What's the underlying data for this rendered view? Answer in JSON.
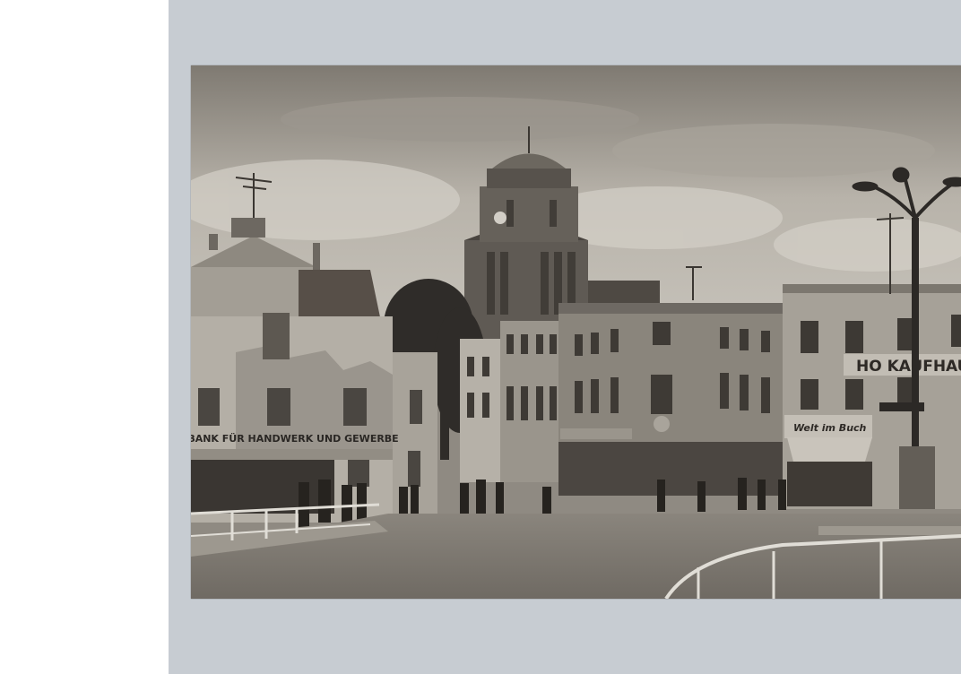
{
  "scan": {
    "background_color": "#c7ccd2",
    "margin_color": "#ffffff"
  },
  "photo": {
    "tone": "sepia-grayscale",
    "signs": {
      "bank": "BANK FÜR HANDWERK UND GEWERBE",
      "department_store": "HO KAUFHAUS",
      "shop_script": "Welt im Buch"
    }
  }
}
